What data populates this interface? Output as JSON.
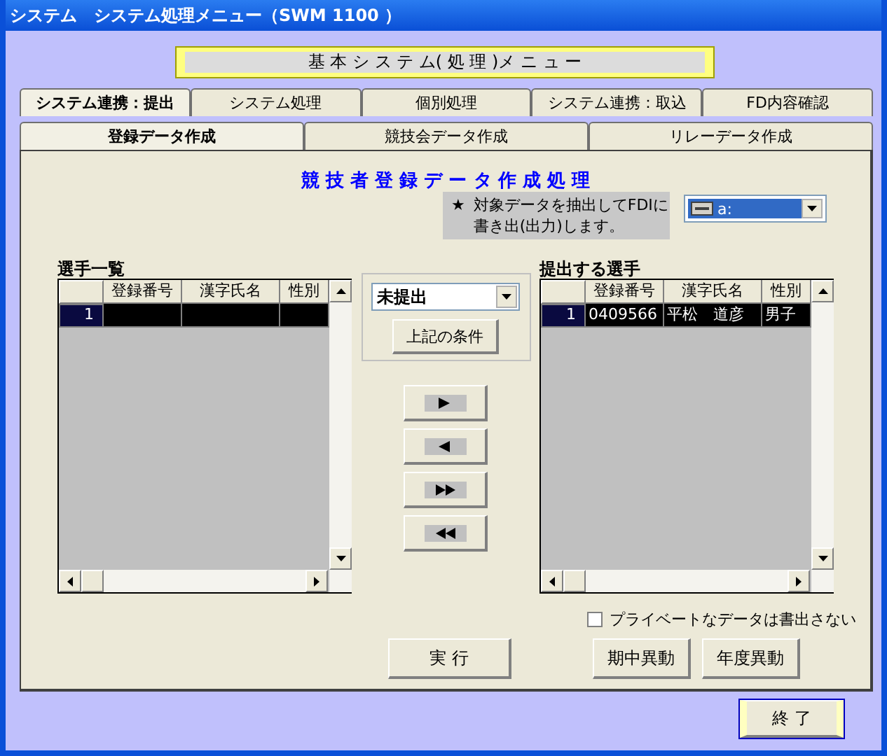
{
  "window": {
    "title": "システム　システム処理メニュー（SWM 1100 ）"
  },
  "header": {
    "title": "基 本 シ ス テ ム( 処 理 )メ ニ ュ ー"
  },
  "tabs": [
    {
      "label": "システム連携：提出",
      "selected": true
    },
    {
      "label": "システム処理",
      "selected": false
    },
    {
      "label": "個別処理",
      "selected": false
    },
    {
      "label": "システム連携：取込",
      "selected": false
    },
    {
      "label": "FD内容確認",
      "selected": false
    }
  ],
  "subtabs": [
    {
      "label": "登録データ作成",
      "selected": true
    },
    {
      "label": "競技会データ作成",
      "selected": false
    },
    {
      "label": "リレーデータ作成",
      "selected": false
    }
  ],
  "heading": "競 技 者 登 録 デ ー タ 作 成 処 理",
  "note": {
    "star": "★",
    "lines": [
      "対象データを抽出してFDIに",
      "書き出(出力)します。"
    ]
  },
  "drive": {
    "value": "a:"
  },
  "players": {
    "label": "選手一覧",
    "columns": [
      "登録番号",
      "漢字氏名",
      "性別"
    ],
    "rows": [
      {
        "index": "1",
        "selected": true
      }
    ]
  },
  "filter": {
    "value": "未提出",
    "button": "上記の条件"
  },
  "move_buttons": [
    {
      "kind": "right"
    },
    {
      "kind": "left"
    },
    {
      "kind": "all_right"
    },
    {
      "kind": "all_left"
    }
  ],
  "submitted": {
    "label": "提出する選手",
    "columns": [
      "登録番号",
      "漢字氏名",
      "性別"
    ],
    "rows": [
      {
        "index": "1",
        "cells": [
          "0409566",
          "平松　道彦",
          "男子"
        ],
        "selected": true
      }
    ]
  },
  "private_option": {
    "label": "プライベートなデータは書出さない",
    "checked": false
  },
  "execute_button": "実 行",
  "change_buttons": [
    "期中異動",
    "年度異動"
  ],
  "exit_button": "終 了"
}
